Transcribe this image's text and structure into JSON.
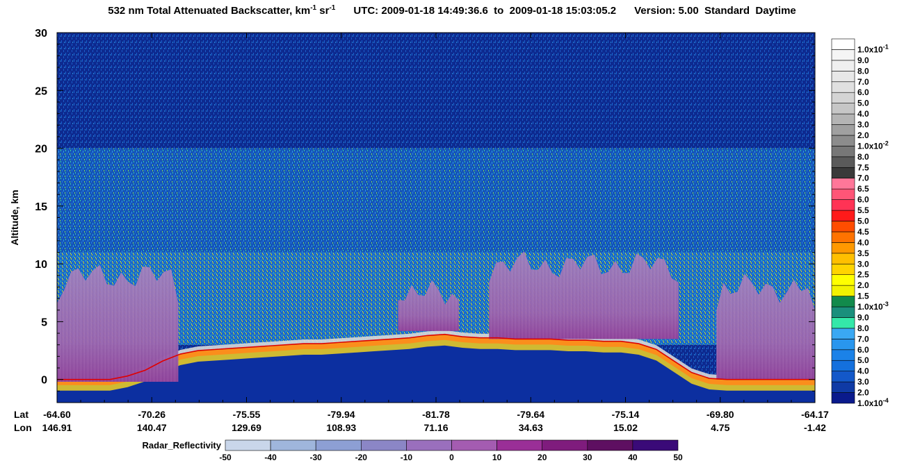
{
  "header": {
    "product": "532 nm Total Attenuated Backscatter, km",
    "unit_exp_1": "-1",
    "unit_sr": " sr",
    "unit_exp_2": "-1",
    "utc_label": "UTC:",
    "start_time": "2009-01-18 14:49:36.6",
    "to_word": "to",
    "end_time": "2009-01-18 15:03:05.2",
    "version": "Version: 5.00",
    "product_type": "Standard",
    "day_night": "Daytime"
  },
  "chart_data": {
    "type": "heatmap",
    "ylabel": "Altitude, km",
    "ylim": [
      -2,
      30
    ],
    "yticks": [
      0,
      5,
      10,
      15,
      20,
      25,
      30
    ],
    "x_row_labels": [
      "Lat",
      "Lon"
    ],
    "x_ticks": [
      {
        "lat": "-64.60",
        "lon": "146.91"
      },
      {
        "lat": "-70.26",
        "lon": "140.47"
      },
      {
        "lat": "-75.55",
        "lon": "129.69"
      },
      {
        "lat": "-79.94",
        "lon": "108.93"
      },
      {
        "lat": "-81.78",
        "lon": "71.16"
      },
      {
        "lat": "-79.64",
        "lon": "34.63"
      },
      {
        "lat": "-75.14",
        "lon": "15.02"
      },
      {
        "lat": "-69.80",
        "lon": "4.75"
      },
      {
        "lat": "-64.17",
        "lon": "-1.42"
      }
    ],
    "surface_altitude_profile": [
      0.0,
      0.0,
      0.0,
      0.0,
      0.3,
      0.8,
      1.6,
      2.2,
      2.5,
      2.6,
      2.7,
      2.8,
      2.9,
      3.0,
      3.1,
      3.1,
      3.2,
      3.3,
      3.4,
      3.5,
      3.6,
      3.8,
      3.9,
      3.7,
      3.6,
      3.6,
      3.5,
      3.5,
      3.5,
      3.4,
      3.4,
      3.3,
      3.3,
      3.1,
      2.6,
      1.6,
      0.6,
      0.1,
      0.0,
      0.0,
      0.0,
      0.0,
      0.0,
      0.0
    ],
    "radar_cloud_segments": [
      {
        "x_range": [
          0.0,
          0.16
        ],
        "base_km": -0.2,
        "top_km": 9.5
      },
      {
        "x_range": [
          0.45,
          0.53
        ],
        "base_km": 4.2,
        "top_km": 8.0
      },
      {
        "x_range": [
          0.57,
          0.82
        ],
        "base_km": 3.5,
        "top_km": 10.5
      },
      {
        "x_range": [
          0.87,
          1.0
        ],
        "base_km": 0.0,
        "top_km": 8.5
      }
    ],
    "backscatter_colorbar": {
      "labels": [
        "1.0x10-4",
        "2.0",
        "3.0",
        "4.0",
        "5.0",
        "6.0",
        "7.0",
        "8.0",
        "9.0",
        "1.0x10-3",
        "1.5",
        "2.0",
        "2.5",
        "3.0",
        "3.5",
        "4.0",
        "4.5",
        "5.0",
        "5.5",
        "6.0",
        "6.5",
        "7.0",
        "7.5",
        "8.0",
        "1.0x10-2",
        "2.0",
        "3.0",
        "4.0",
        "5.0",
        "6.0",
        "7.0",
        "8.0",
        "9.0",
        "1.0x10-1"
      ],
      "colors": [
        "#0a1a8c",
        "#0f3aa5",
        "#1358c9",
        "#1470dd",
        "#1b82e8",
        "#2996ee",
        "#3aa8f3",
        "#34e8a9",
        "#1a8f7c",
        "#128a4c",
        "#f2f200",
        "#ffff00",
        "#ffd400",
        "#ffbf00",
        "#ff9900",
        "#ff7300",
        "#ff4d00",
        "#ff1a1a",
        "#ff3355",
        "#ff5577",
        "#ff7799",
        "#3a3a3a",
        "#5a5a5a",
        "#777777",
        "#8c8c8c",
        "#a0a0a0",
        "#b4b4b4",
        "#c6c6c6",
        "#d4d4d4",
        "#e0e0e0",
        "#e8e8e8",
        "#efefef",
        "#f5f5f5",
        "#ffffff"
      ]
    },
    "radar_colorbar": {
      "title": "Radar_Reflectivity",
      "ticks": [
        "-50",
        "-40",
        "-30",
        "-20",
        "-10",
        "0",
        "10",
        "20",
        "30",
        "40",
        "50"
      ],
      "colors": [
        "#c9d6ea",
        "#9fb6dc",
        "#8d9fd4",
        "#8b86c6",
        "#9a6fbd",
        "#a45cb1",
        "#9a2f97",
        "#7f1c7d",
        "#5e0f61",
        "#3a0a78"
      ]
    }
  },
  "colors": {
    "background_fill": "#0b2d96",
    "upper_fill": "#0d2a8f",
    "mid_noise": "#1a6fd6",
    "surface_line": "#e00000",
    "cloud_fill": "#a07ab8",
    "cloud_dense": "#8a2b8e"
  }
}
